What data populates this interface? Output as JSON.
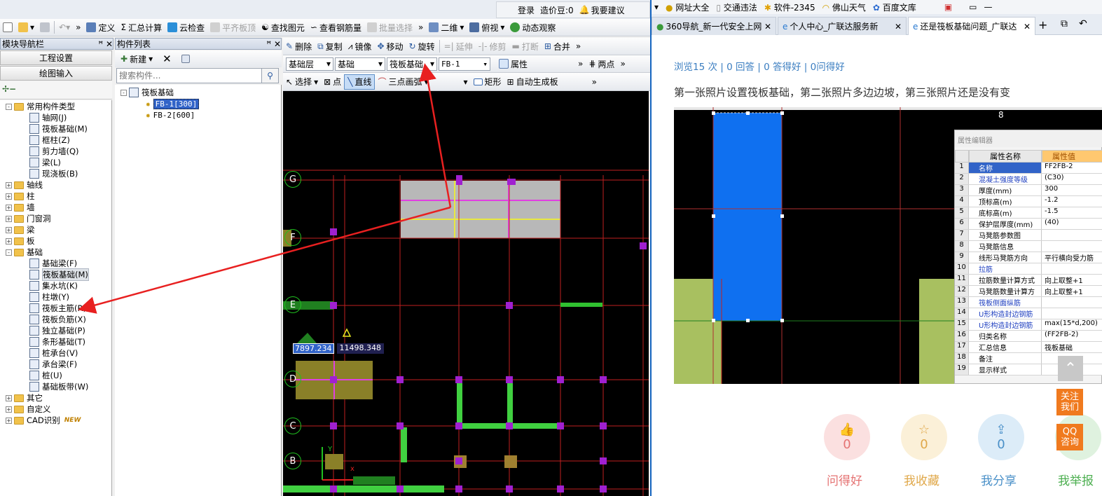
{
  "left_app": {
    "top_bar": {
      "login": "登录",
      "price": "造价豆:0",
      "suggest": "我要建议"
    },
    "toolbar1": {
      "define": "定义",
      "sum_calc": "汇总计算",
      "cloud_check": "云检查",
      "flat_slab_top": "平齐板顶",
      "find_element": "查找图元",
      "view_rebar": "查看钢筋量",
      "batch_select": "批量选择",
      "view_2d": "二维",
      "view_top": "俯视",
      "dynamic_view": "动态观察"
    },
    "toolbar2": {
      "delete": "删除",
      "copy": "复制",
      "mirror": "镜像",
      "move": "移动",
      "rotate": "旋转",
      "extend": "延伸",
      "trim": "修剪",
      "break": "打断",
      "merge": "合并"
    },
    "toolbar3": {
      "layer": "基础层",
      "category": "基础",
      "element_type": "筏板基础",
      "element_name": "FB-1",
      "property": "属性",
      "two_points": "两点"
    },
    "toolbar4": {
      "select": "选择",
      "point": "点",
      "line": "直线",
      "arc": "三点画弧",
      "rect": "矩形",
      "auto_gen": "自动生成板"
    },
    "nav_panel": {
      "title": "模块导航栏",
      "btn_project": "工程设置",
      "btn_draw": "绘图输入",
      "tree": [
        {
          "label": "常用构件类型",
          "level": 0,
          "kind": "folder",
          "expand": "-"
        },
        {
          "label": "轴网(J)",
          "level": 1,
          "kind": "item"
        },
        {
          "label": "筏板基础(M)",
          "level": 1,
          "kind": "item"
        },
        {
          "label": "框柱(Z)",
          "level": 1,
          "kind": "item"
        },
        {
          "label": "剪力墙(Q)",
          "level": 1,
          "kind": "item"
        },
        {
          "label": "梁(L)",
          "level": 1,
          "kind": "item"
        },
        {
          "label": "现浇板(B)",
          "level": 1,
          "kind": "item"
        },
        {
          "label": "轴线",
          "level": 0,
          "kind": "folder",
          "expand": "+"
        },
        {
          "label": "柱",
          "level": 0,
          "kind": "folder",
          "expand": "+"
        },
        {
          "label": "墙",
          "level": 0,
          "kind": "folder",
          "expand": "+"
        },
        {
          "label": "门窗洞",
          "level": 0,
          "kind": "folder",
          "expand": "+"
        },
        {
          "label": "梁",
          "level": 0,
          "kind": "folder",
          "expand": "+"
        },
        {
          "label": "板",
          "level": 0,
          "kind": "folder",
          "expand": "+"
        },
        {
          "label": "基础",
          "level": 0,
          "kind": "folder",
          "expand": "-"
        },
        {
          "label": "基础梁(F)",
          "level": 1,
          "kind": "item"
        },
        {
          "label": "筏板基础(M)",
          "level": 1,
          "kind": "item",
          "selected": true
        },
        {
          "label": "集水坑(K)",
          "level": 1,
          "kind": "item"
        },
        {
          "label": "柱墩(Y)",
          "level": 1,
          "kind": "item"
        },
        {
          "label": "筏板主筋(R)",
          "level": 1,
          "kind": "item"
        },
        {
          "label": "筏板负筋(X)",
          "level": 1,
          "kind": "item"
        },
        {
          "label": "独立基础(P)",
          "level": 1,
          "kind": "item"
        },
        {
          "label": "条形基础(T)",
          "level": 1,
          "kind": "item"
        },
        {
          "label": "桩承台(V)",
          "level": 1,
          "kind": "item"
        },
        {
          "label": "承台梁(F)",
          "level": 1,
          "kind": "item"
        },
        {
          "label": "桩(U)",
          "level": 1,
          "kind": "item"
        },
        {
          "label": "基础板带(W)",
          "level": 1,
          "kind": "item"
        },
        {
          "label": "其它",
          "level": 0,
          "kind": "folder",
          "expand": "+"
        },
        {
          "label": "自定义",
          "level": 0,
          "kind": "folder",
          "expand": "+"
        },
        {
          "label": "CAD识别",
          "level": 0,
          "kind": "folder",
          "expand": "+",
          "badge": "NEW"
        }
      ]
    },
    "element_panel": {
      "title": "构件列表",
      "new_btn": "新建",
      "search_placeholder": "搜索构件...",
      "root": "筏板基础",
      "items": [
        "FB-1[300]",
        "FB-2[600]"
      ]
    },
    "canvas": {
      "axes": [
        "G",
        "F",
        "E",
        "D",
        "C",
        "B"
      ],
      "coord_x": "7897.234",
      "coord_y": "11498.348"
    }
  },
  "right_app": {
    "bookmarks": [
      "网址大全",
      "交通违法",
      "软件-2345",
      "佛山天气",
      "百度文库"
    ],
    "tabs": [
      "360导航_新一代安全上网",
      "个人中心_广联达服务新",
      "还是筏板基础问题_广联达"
    ],
    "stats": "浏览15 次 | 0 回答 | 0 答得好 | 0问得好",
    "question": "第一张照片设置筏板基础，第二张照片多边边坡，第三张照片还是没有变",
    "screenshot": {
      "axis_label": "8",
      "panel_title": "属性编辑器",
      "col_name": "属性名称",
      "col_value": "属性值",
      "rows": [
        {
          "n": "1",
          "k": "名称",
          "v": "FF2FB-2"
        },
        {
          "n": "2",
          "k": "混凝土强度等级",
          "v": "(C30)"
        },
        {
          "n": "3",
          "k": "厚度(mm)",
          "v": "300"
        },
        {
          "n": "4",
          "k": "顶标高(m)",
          "v": "-1.2"
        },
        {
          "n": "5",
          "k": "底标高(m)",
          "v": "-1.5"
        },
        {
          "n": "6",
          "k": "保护层厚度(mm)",
          "v": "(40)"
        },
        {
          "n": "7",
          "k": "马凳筋参数图",
          "v": ""
        },
        {
          "n": "8",
          "k": "马凳筋信息",
          "v": ""
        },
        {
          "n": "9",
          "k": "线形马凳筋方向",
          "v": "平行横向受力筋"
        },
        {
          "n": "10",
          "k": "拉筋",
          "v": ""
        },
        {
          "n": "11",
          "k": "拉筋数量计算方式",
          "v": "向上取整+1"
        },
        {
          "n": "12",
          "k": "马凳筋数量计算方",
          "v": "向上取整+1"
        },
        {
          "n": "13",
          "k": "筏板侧面纵筋",
          "v": ""
        },
        {
          "n": "14",
          "k": "U形构造封边钢筋",
          "v": ""
        },
        {
          "n": "15",
          "k": "U形构造封边钢筋",
          "v": "max(15*d,200)"
        },
        {
          "n": "16",
          "k": "归类名称",
          "v": "(FF2FB-2)"
        },
        {
          "n": "17",
          "k": "汇总信息",
          "v": "筏板基础"
        },
        {
          "n": "18",
          "k": "备注",
          "v": ""
        },
        {
          "n": "19",
          "k": "显示样式",
          "v": ""
        }
      ]
    },
    "actions": [
      {
        "label": "问得好",
        "count": "0",
        "color": "#e57373"
      },
      {
        "label": "我收藏",
        "count": "0",
        "color": "#e0a84a"
      },
      {
        "label": "我分享",
        "count": "0",
        "color": "#4a90c8"
      },
      {
        "label": "我举报",
        "count": "",
        "color": "#4caf50"
      }
    ],
    "side": {
      "follow": "关注我们",
      "qq": "QQ咨询"
    }
  }
}
